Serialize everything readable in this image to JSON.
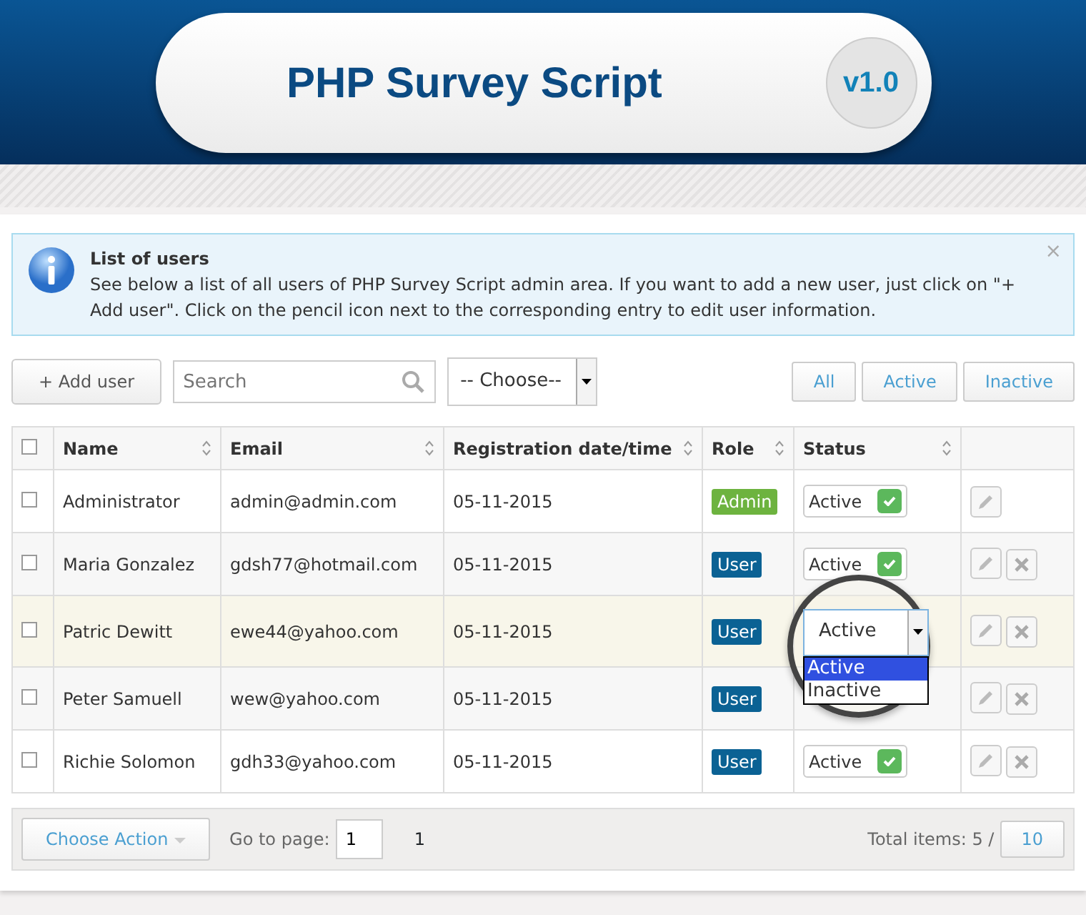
{
  "header": {
    "title": "PHP Survey Script",
    "version": "v1.0"
  },
  "notice": {
    "title": "List of users",
    "text": "See below a list of all users of PHP Survey Script admin area. If you want to add a new user, just click on \"+ Add user\". Click on the pencil icon next to the corresponding entry to edit user information.",
    "close": "×"
  },
  "toolbar": {
    "add_button": "+ Add user",
    "search": {
      "placeholder": "Search"
    },
    "choose": {
      "value": "-- Choose--"
    },
    "filters": [
      {
        "label": "All",
        "selected": false
      },
      {
        "label": "Active",
        "selected": false
      },
      {
        "label": "Inactive",
        "selected": false
      }
    ]
  },
  "table": {
    "all_checked": false,
    "columns": [
      "Name",
      "Email",
      "Registration date/time",
      "Role",
      "Status"
    ],
    "rows": [
      {
        "name": "Administrator",
        "email": "admin@admin.com",
        "date": "05-11-2015",
        "role": {
          "label": "Admin",
          "kind": "admin"
        },
        "status": {
          "kind": "toggle",
          "label": "Active",
          "checked": true
        },
        "deletable": false,
        "highlighted": false,
        "checked": false
      },
      {
        "name": "Maria Gonzalez",
        "email": "gdsh77@hotmail.com",
        "date": "05-11-2015",
        "role": {
          "label": "User",
          "kind": "user"
        },
        "status": {
          "kind": "toggle",
          "label": "Active",
          "checked": true
        },
        "deletable": true,
        "highlighted": false,
        "checked": false
      },
      {
        "name": "Patric Dewitt",
        "email": "ewe44@yahoo.com",
        "date": "05-11-2015",
        "role": {
          "label": "User",
          "kind": "user"
        },
        "status": {
          "kind": "dropdown",
          "label": "Active",
          "options": [
            {
              "label": "Active",
              "selected": true
            },
            {
              "label": "Inactive",
              "selected": false
            }
          ]
        },
        "deletable": true,
        "highlighted": true,
        "checked": false
      },
      {
        "name": "Peter Samuell",
        "email": "wew@yahoo.com",
        "date": "05-11-2015",
        "role": {
          "label": "User",
          "kind": "user"
        },
        "status": {
          "kind": "hidden"
        },
        "deletable": true,
        "highlighted": false,
        "checked": false
      },
      {
        "name": "Richie Solomon",
        "email": "gdh33@yahoo.com",
        "date": "05-11-2015",
        "role": {
          "label": "User",
          "kind": "user"
        },
        "status": {
          "kind": "toggle",
          "label": "Active",
          "checked": true
        },
        "deletable": true,
        "highlighted": false,
        "checked": false
      }
    ]
  },
  "footer": {
    "action_button": "Choose Action",
    "goto_label": "Go to page:",
    "page_value": "1",
    "page_number": "1",
    "total_label": "Total items: 5 /",
    "per_page": "10"
  }
}
